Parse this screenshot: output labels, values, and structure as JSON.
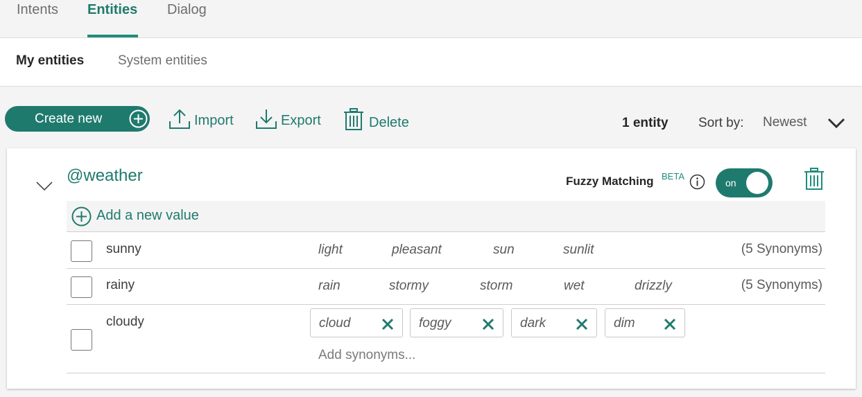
{
  "top_tabs": [
    "Intents",
    "Entities",
    "Dialog"
  ],
  "sub_tabs": [
    "My entities",
    "System entities"
  ],
  "toolbar": {
    "create_label": "Create new",
    "import_label": "Import",
    "export_label": "Export",
    "delete_label": "Delete",
    "entity_count": "1 entity",
    "sort_label": "Sort by:",
    "sort_value": "Newest"
  },
  "entity": {
    "name": "@weather",
    "fuzzy_label": "Fuzzy Matching",
    "beta": "BETA",
    "toggle_label": "on",
    "add_value_label": "Add a new value",
    "values": [
      {
        "name": "sunny",
        "synonyms": [
          "light",
          "pleasant",
          "sun",
          "sunlit"
        ],
        "count": "(5 Synonyms)"
      },
      {
        "name": "rainy",
        "synonyms": [
          "rain",
          "stormy",
          "storm",
          "wet",
          "drizzly"
        ],
        "count": "(5 Synonyms)"
      },
      {
        "name": "cloudy",
        "synonyms": [
          "cloud",
          "foggy",
          "dark",
          "dim"
        ],
        "add_placeholder": "Add synonyms..."
      }
    ]
  },
  "colors": {
    "accent": "#1f7a6e",
    "background": "#f4f4f4"
  }
}
